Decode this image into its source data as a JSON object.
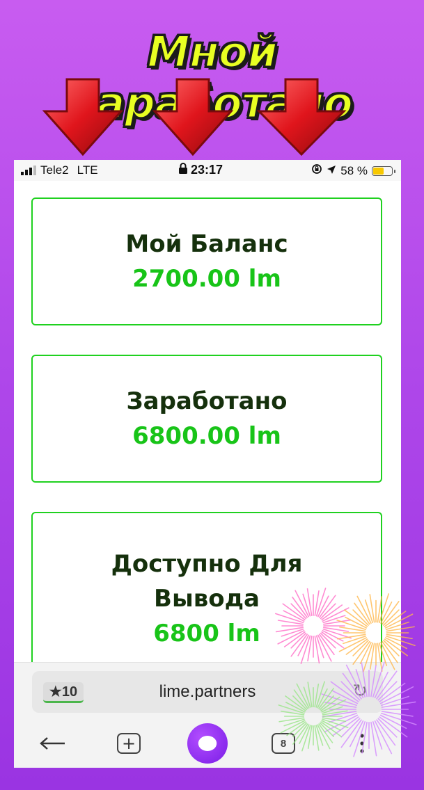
{
  "headline": "Мной заработано",
  "status_bar": {
    "carrier": "Tele2",
    "network": "LTE",
    "time": "23:17",
    "battery": "58 %",
    "battery_level": 0.58,
    "battery_color": "#f7c800"
  },
  "cards": [
    {
      "title": "Мой Баланс",
      "value": "2700.00 lm"
    },
    {
      "title": "Заработано",
      "value": "6800.00 lm"
    },
    {
      "title": "Доступно Для Вывода",
      "value": "6800 lm"
    }
  ],
  "browser": {
    "bookmark_count": "10",
    "url": "lime.partners",
    "tabs_count": "8"
  },
  "icons": [
    "arrow-down-icon",
    "signal-icon",
    "lock-icon",
    "rotation-lock-icon",
    "location-icon",
    "battery-icon",
    "star-icon",
    "reload-icon",
    "back-arrow-icon",
    "new-tab-icon",
    "alice-assistant-icon",
    "tabs-icon",
    "more-menu-icon",
    "fireworks-icon"
  ],
  "colors": {
    "background": "#b048ea",
    "headline_fill": "#e8ff22",
    "card_border": "#1fd11f",
    "card_value": "#18c418",
    "card_title": "#15300c",
    "arrow_red": "#e0151c"
  }
}
